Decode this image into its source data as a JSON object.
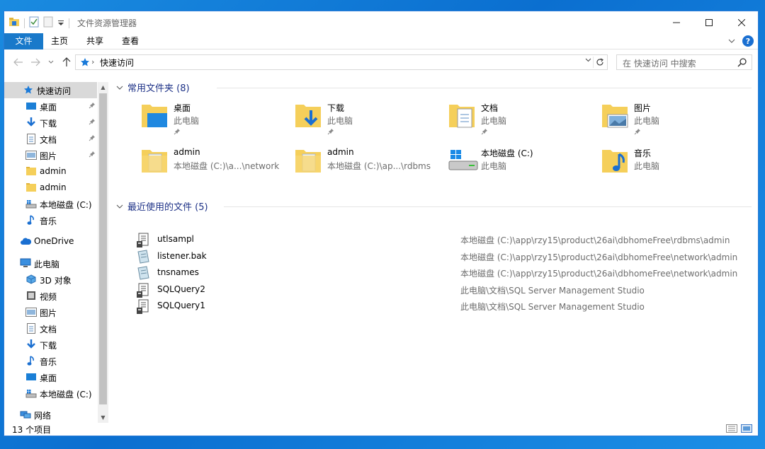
{
  "window": {
    "title": "文件资源管理器"
  },
  "ribbon": {
    "tabs": [
      "文件",
      "主页",
      "共享",
      "查看"
    ]
  },
  "address": {
    "path": "快速访问",
    "search_placeholder": "在 快速访问 中搜索"
  },
  "sidebar": {
    "items": [
      {
        "label": "快速访问",
        "icon": "star-icon",
        "pinned": false,
        "selected": true
      },
      {
        "label": "桌面",
        "icon": "desktop-icon",
        "pinned": true
      },
      {
        "label": "下载",
        "icon": "download-icon",
        "pinned": true
      },
      {
        "label": "文档",
        "icon": "document-icon",
        "pinned": true
      },
      {
        "label": "图片",
        "icon": "picture-icon",
        "pinned": true
      },
      {
        "label": "admin",
        "icon": "folder-icon",
        "pinned": false
      },
      {
        "label": "admin",
        "icon": "folder-icon",
        "pinned": false
      },
      {
        "label": "本地磁盘 (C:)",
        "icon": "drive-icon",
        "pinned": false
      },
      {
        "label": "音乐",
        "icon": "music-icon",
        "pinned": false
      },
      {
        "label": "OneDrive",
        "icon": "cloud-icon",
        "pinned": false
      },
      {
        "label": "此电脑",
        "icon": "pc-icon",
        "pinned": false
      },
      {
        "label": "3D 对象",
        "icon": "cube-icon",
        "pinned": false
      },
      {
        "label": "视频",
        "icon": "video-icon",
        "pinned": false
      },
      {
        "label": "图片",
        "icon": "picture-icon",
        "pinned": false
      },
      {
        "label": "文档",
        "icon": "document-icon",
        "pinned": false
      },
      {
        "label": "下载",
        "icon": "download-icon",
        "pinned": false
      },
      {
        "label": "音乐",
        "icon": "music-icon",
        "pinned": false
      },
      {
        "label": "桌面",
        "icon": "desktop-icon",
        "pinned": false
      },
      {
        "label": "本地磁盘 (C:)",
        "icon": "drive-icon",
        "pinned": false
      },
      {
        "label": "网络",
        "icon": "network-icon",
        "pinned": false
      }
    ]
  },
  "frequent": {
    "header": "常用文件夹 (8)",
    "tiles": [
      {
        "name": "桌面",
        "sub": "此电脑",
        "icon": "desktop-folder-icon",
        "pinned": true
      },
      {
        "name": "下载",
        "sub": "此电脑",
        "icon": "download-folder-icon",
        "pinned": true
      },
      {
        "name": "文档",
        "sub": "此电脑",
        "icon": "document-folder-icon",
        "pinned": true
      },
      {
        "name": "图片",
        "sub": "此电脑",
        "icon": "picture-folder-icon",
        "pinned": true
      },
      {
        "name": "admin",
        "sub": "本地磁盘 (C:)\\a...\\network",
        "icon": "folder-icon",
        "pinned": false
      },
      {
        "name": "admin",
        "sub": "本地磁盘 (C:)\\ap...\\rdbms",
        "icon": "folder-icon",
        "pinned": false
      },
      {
        "name": "本地磁盘 (C:)",
        "sub": "此电脑",
        "icon": "drive-icon",
        "pinned": false
      },
      {
        "name": "音乐",
        "sub": "此电脑",
        "icon": "music-folder-icon",
        "pinned": false
      }
    ]
  },
  "recent": {
    "header": "最近使用的文件 (5)",
    "files": [
      {
        "name": "utlsampl",
        "path": "本地磁盘 (C:)\\app\\rzy15\\product\\26ai\\dbhomeFree\\rdbms\\admin",
        "icon": "sql-file-icon"
      },
      {
        "name": "listener.bak",
        "path": "本地磁盘 (C:)\\app\\rzy15\\product\\26ai\\dbhomeFree\\network\\admin",
        "icon": "bak-file-icon"
      },
      {
        "name": "tnsnames",
        "path": "本地磁盘 (C:)\\app\\rzy15\\product\\26ai\\dbhomeFree\\network\\admin",
        "icon": "ora-file-icon"
      },
      {
        "name": "SQLQuery2",
        "path": "此电脑\\文档\\SQL Server Management Studio",
        "icon": "sql-file-icon"
      },
      {
        "name": "SQLQuery1",
        "path": "此电脑\\文档\\SQL Server Management Studio",
        "icon": "sql-file-icon"
      }
    ]
  },
  "status": {
    "count": "13 个项目"
  },
  "colors": {
    "accent": "#1979ca",
    "group_header": "#1e3287",
    "folder": "#f5cf5a"
  }
}
